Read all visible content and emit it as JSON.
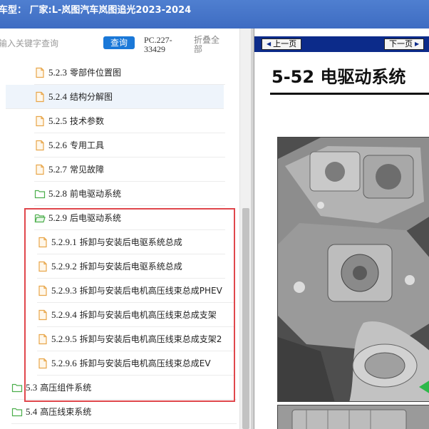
{
  "window": {
    "title": "车型： 厂家:L-岚图汽车岚图追光2023-2024"
  },
  "search": {
    "placeholder": "输入关键字查询",
    "button_label": "查询",
    "code_label": "PC.227-33429",
    "collapse_label": "折叠全部"
  },
  "tree": {
    "items": [
      {
        "num": "5.2.3",
        "label": "零部件位置图",
        "icon": "file-icon"
      },
      {
        "num": "5.2.4",
        "label": "结构分解图",
        "icon": "file-icon",
        "selected": true
      },
      {
        "num": "5.2.5",
        "label": "技术参数",
        "icon": "file-icon"
      },
      {
        "num": "5.2.6",
        "label": "专用工具",
        "icon": "file-icon"
      },
      {
        "num": "5.2.7",
        "label": "常见故障",
        "icon": "file-icon"
      },
      {
        "num": "5.2.8",
        "label": "前电驱动系统",
        "icon": "folder-icon"
      },
      {
        "num": "5.2.9",
        "label": "后电驱动系统",
        "icon": "folder-open-icon"
      },
      {
        "num": "5.2.9.1",
        "label": "拆卸与安装后电驱系统总成",
        "icon": "file-icon"
      },
      {
        "num": "5.2.9.2",
        "label": "拆卸与安装后电驱系统总成",
        "icon": "file-icon"
      },
      {
        "num": "5.2.9.3",
        "label": "拆卸与安装后电机高压线束总成PHEV",
        "icon": "file-icon"
      },
      {
        "num": "5.2.9.4",
        "label": "拆卸与安装后电机高压线束总成支架",
        "icon": "file-icon"
      },
      {
        "num": "5.2.9.5",
        "label": "拆卸与安装后电机高压线束总成支架2",
        "icon": "file-icon"
      },
      {
        "num": "5.2.9.6",
        "label": "拆卸与安装后电机高压线束总成EV",
        "icon": "file-icon"
      },
      {
        "num": "5.3",
        "label": "高压组件系统",
        "icon": "folder-icon"
      },
      {
        "num": "5.4",
        "label": "高压线束系统",
        "icon": "folder-icon"
      }
    ]
  },
  "viewer": {
    "prev_label": "上一页",
    "next_label": "下一页",
    "page_title": "5-52 电驱动系统"
  },
  "colors": {
    "title_bar": "#4a7bcf",
    "search_button": "#1a78d8",
    "highlight_box": "#e0474c",
    "viewer_toolbar": "#0c2b8a",
    "file_icon": "#e8a64a",
    "folder_icon": "#4cae4c"
  }
}
